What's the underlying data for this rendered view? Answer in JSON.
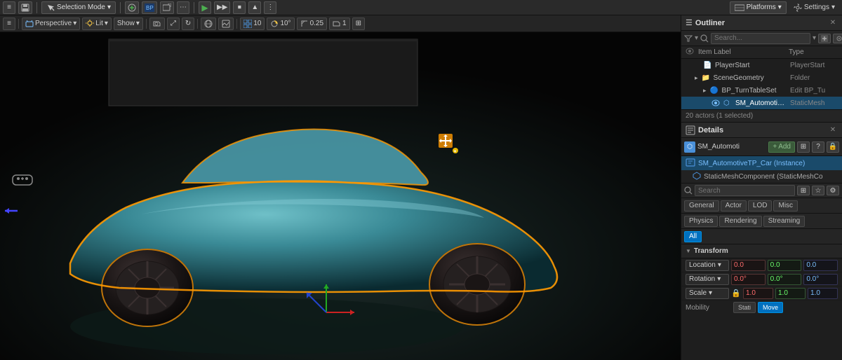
{
  "topToolbar": {
    "menu_icon": "≡",
    "save_icon": "💾",
    "selection_mode_label": "Selection Mode",
    "add_icon": "+",
    "blueprint_icon": "⬡",
    "cinematics_icon": "🎬",
    "play_icon": "▶",
    "simulate_icon": "⏩",
    "stop_icon": "⏹",
    "settings_icon": "⚙",
    "platforms_label": "Platforms",
    "settings_label": "Settings"
  },
  "viewportToolbar": {
    "perspective_label": "Perspective",
    "lit_label": "Lit",
    "show_label": "Show",
    "grid_size": "10",
    "rotation_snap": "10°",
    "scale_snap": "0.25",
    "camera_speed": "1"
  },
  "outliner": {
    "title": "Outliner",
    "search_placeholder": "Search...",
    "col_item_label": "Item Label",
    "col_type": "Type",
    "items": [
      {
        "indent": 2,
        "icon": "📁",
        "name": "PlayerStart",
        "type": "PlayerStart"
      },
      {
        "indent": 1,
        "icon": "📁",
        "name": "SceneGeometry",
        "type": "Folder"
      },
      {
        "indent": 2,
        "icon": "🔵",
        "name": "BP_TurnTableSet",
        "type": "Edit BP_Tu"
      },
      {
        "indent": 3,
        "icon": "🔷",
        "name": "SM_AutomotiveTi",
        "type": "StaticMesh",
        "selected": true
      }
    ],
    "status": "20 actors (1 selected)"
  },
  "details": {
    "title": "Details",
    "component_name": "SM_Automoti",
    "add_label": "+ Add",
    "selected_actor": "SM_AutomotiveTP_Car (Instance)",
    "component_row": "StaticMeshComponent (StaticMeshCo",
    "search_placeholder": "Search",
    "tabs": [
      {
        "label": "General",
        "active": false
      },
      {
        "label": "Actor",
        "active": false
      },
      {
        "label": "LOD",
        "active": false
      },
      {
        "label": "Misc",
        "active": false
      }
    ],
    "sub_tabs": [
      {
        "label": "Physics",
        "active": false
      },
      {
        "label": "Rendering",
        "active": false
      },
      {
        "label": "Streaming",
        "active": false
      }
    ],
    "all_tab": "All",
    "transform_section": "Transform",
    "location_label": "Location",
    "location_values": [
      "0.0",
      "0.0",
      "0.0"
    ],
    "rotation_label": "Rotation",
    "rotation_values": [
      "0.0°",
      "0.0°",
      "0.0°"
    ],
    "scale_label": "Scale",
    "scale_values": [
      "1.0",
      "1.0",
      "1.0"
    ],
    "mobility_label": "Mobility",
    "mobility_static": "Stati",
    "mobility_move": "Move"
  }
}
